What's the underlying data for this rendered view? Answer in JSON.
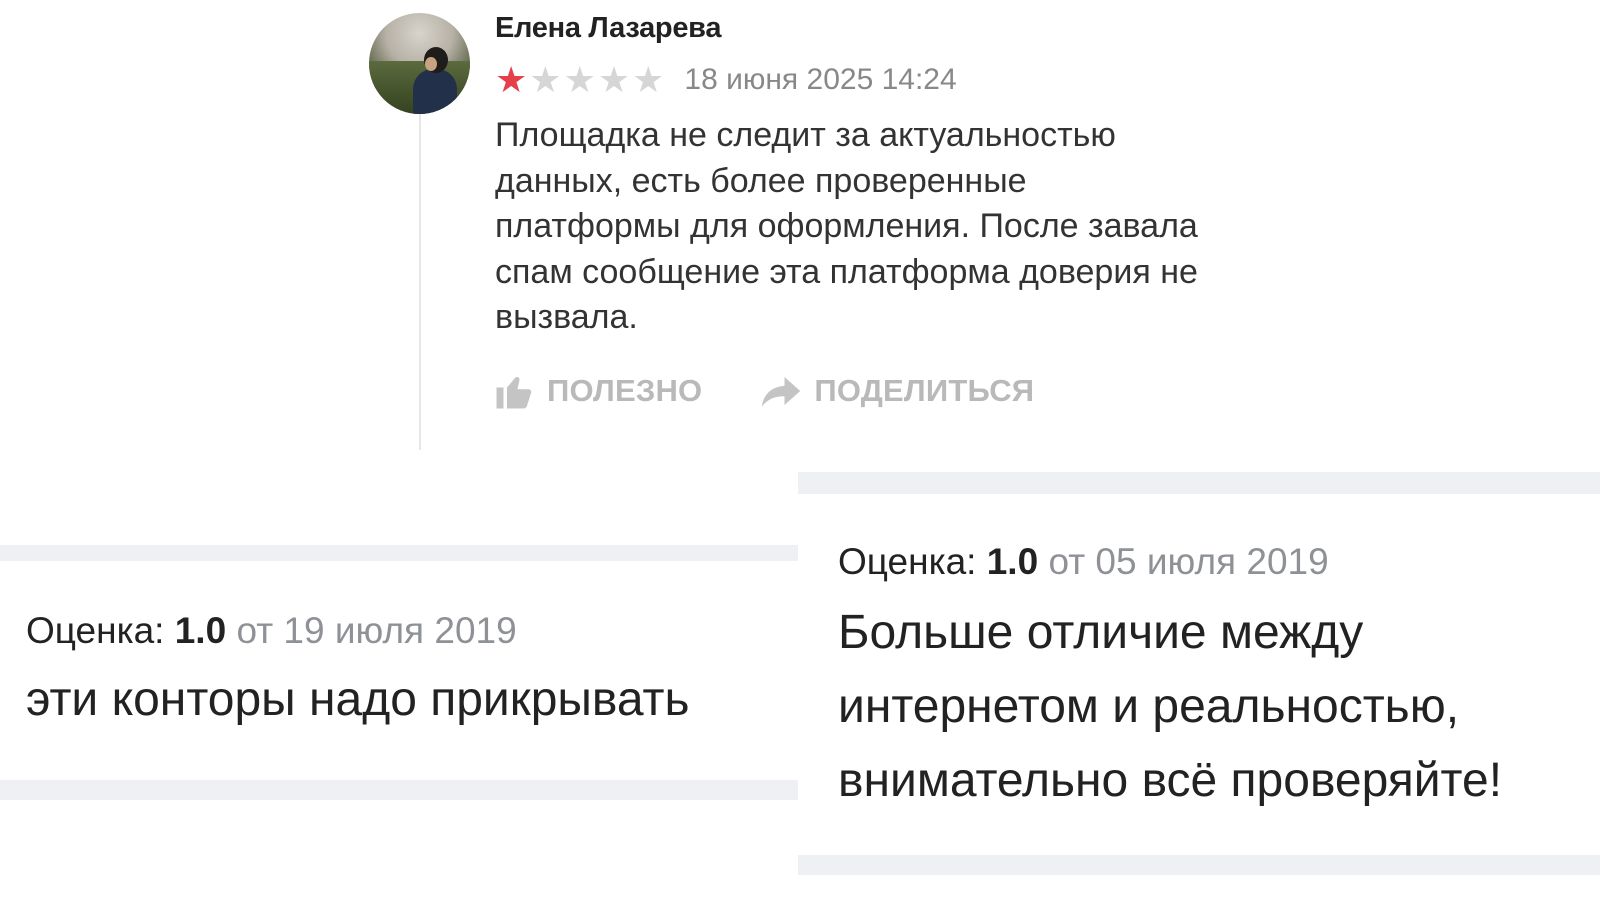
{
  "top_review": {
    "author": "Елена Лазарева",
    "rating_stars": 1,
    "max_stars": 5,
    "star_filled_color": "#e5404a",
    "star_empty_color": "#d6d6d6",
    "date": "18 июня 2025 14:24",
    "text": "Площадка не следит за актуальностью данных, есть более проверенные платформы для оформления. После завала спам сообщение эта платформа доверия не вызвала.",
    "actions": {
      "helpful_label": "ПОЛЕЗНО",
      "helpful_icon": "thumbs-up-icon",
      "share_label": "ПОДЕЛИТЬСЯ",
      "share_icon": "share-arrow-icon"
    }
  },
  "left_review": {
    "rating_prefix": "Оценка:",
    "score": "1.0",
    "date": "от 19 июля 2019",
    "text": "эти конторы надо прикрывать"
  },
  "right_review": {
    "rating_prefix": "Оценка:",
    "score": "1.0",
    "date": "от 05 июля 2019",
    "text_lines": [
      "Больше отличие между",
      "интернетом и реальностью,",
      "внимательно всё проверяйте!"
    ]
  }
}
